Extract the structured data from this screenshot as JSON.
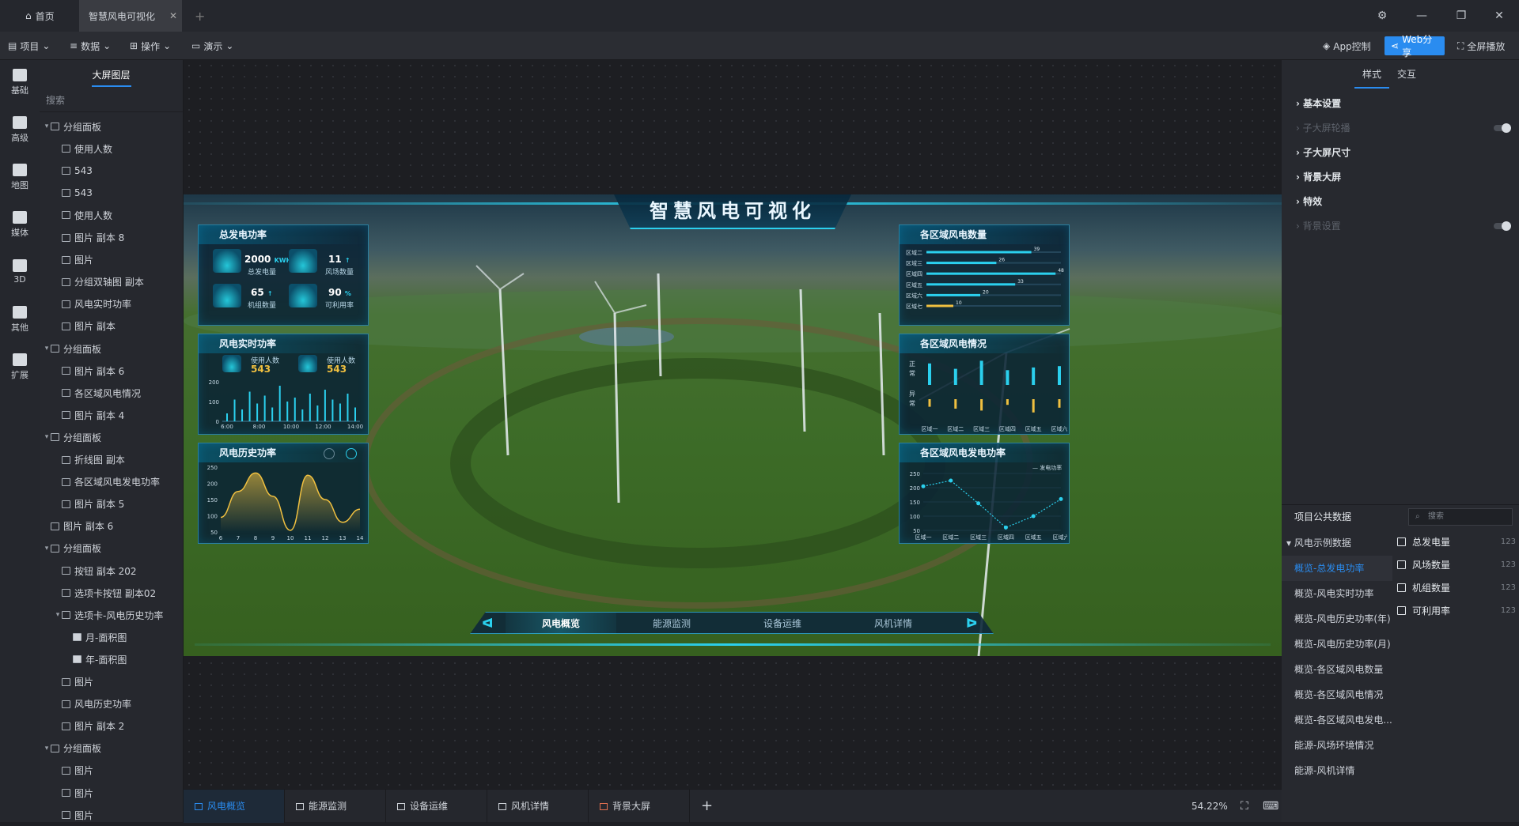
{
  "titlebar": {
    "home_label": "首页",
    "active_tab": "智慧风电可视化",
    "add_tab": "+",
    "settings_icon": "gear-icon"
  },
  "menubar": {
    "items": [
      "项目",
      "数据",
      "操作",
      "演示"
    ],
    "app_control": "App控制",
    "web_share": "Web分享",
    "fullscreen": "全屏播放"
  },
  "iconbar": {
    "items": [
      "基础",
      "高级",
      "地图",
      "媒体",
      "3D",
      "其他",
      "扩展"
    ]
  },
  "layers": {
    "tab": "大屏图层",
    "search_placeholder": "搜索",
    "rows": [
      {
        "label": "分组面板",
        "type": "group",
        "level": 0,
        "open": true
      },
      {
        "label": "使用人数",
        "type": "text",
        "level": 1
      },
      {
        "label": "543",
        "type": "text",
        "level": 1
      },
      {
        "label": "543",
        "type": "text",
        "level": 1
      },
      {
        "label": "使用人数",
        "type": "text",
        "level": 1
      },
      {
        "label": "图片 副本 8",
        "type": "image",
        "level": 1
      },
      {
        "label": "图片",
        "type": "image",
        "level": 1
      },
      {
        "label": "分组双轴图 副本",
        "type": "chart",
        "level": 1
      },
      {
        "label": "风电实时功率",
        "type": "text",
        "level": 1
      },
      {
        "label": "图片 副本",
        "type": "image",
        "level": 1
      },
      {
        "label": "分组面板",
        "type": "group",
        "level": 0,
        "open": true
      },
      {
        "label": "图片 副本 6",
        "type": "image",
        "level": 1
      },
      {
        "label": "各区域风电情况",
        "type": "text",
        "level": 1
      },
      {
        "label": "图片 副本 4",
        "type": "image",
        "level": 1
      },
      {
        "label": "分组面板",
        "type": "group",
        "level": 0,
        "open": true
      },
      {
        "label": "折线图 副本",
        "type": "line",
        "level": 1
      },
      {
        "label": "各区域风电发电功率",
        "type": "text",
        "level": 1
      },
      {
        "label": "图片 副本 5",
        "type": "image",
        "level": 1
      },
      {
        "label": "图片 副本 6",
        "type": "image",
        "level": 0
      },
      {
        "label": "分组面板",
        "type": "group",
        "level": 0,
        "open": true
      },
      {
        "label": "按钮 副本 202",
        "type": "button",
        "level": 1
      },
      {
        "label": "选项卡按钮 副本02",
        "type": "button",
        "level": 1
      },
      {
        "label": "选项卡-风电历史功率",
        "type": "tabs",
        "level": 1,
        "open": true
      },
      {
        "label": "月-面积图",
        "type": "folder",
        "level": 2
      },
      {
        "label": "年-面积图",
        "type": "folder",
        "level": 2
      },
      {
        "label": "图片",
        "type": "image",
        "level": 1
      },
      {
        "label": "风电历史功率",
        "type": "text",
        "level": 1
      },
      {
        "label": "图片 副本 2",
        "type": "image",
        "level": 1
      },
      {
        "label": "分组面板",
        "type": "group",
        "level": 0,
        "open": true
      },
      {
        "label": "图片",
        "type": "image",
        "level": 1
      },
      {
        "label": "图片",
        "type": "image",
        "level": 1
      },
      {
        "label": "图片",
        "type": "image",
        "level": 1
      }
    ]
  },
  "screen": {
    "title": "智慧风电可视化",
    "p1": {
      "title": "总发电功率",
      "k1_val": "2000",
      "k1_unit": "KWH",
      "k1_label": "总发电量",
      "k2_val": "11",
      "k2_label": "风场数量",
      "k3_val": "65",
      "k3_label": "机组数量",
      "k4_val": "90",
      "k4_unit": "%",
      "k4_label": "可利用率"
    },
    "p2": {
      "title": "风电实时功率",
      "u1_label": "使用人数",
      "u1_val": "543",
      "u2_label": "使用人数",
      "u2_val": "543"
    },
    "p3": {
      "title": "风电历史功率"
    },
    "p4": {
      "title": "各区域风电数量"
    },
    "p5": {
      "title": "各区域风电情况",
      "normal": "正常",
      "abnormal": "异常"
    },
    "p6": {
      "title": "各区域风电发电功率",
      "legend": "发电功率"
    },
    "nav": [
      "风电概览",
      "能源监测",
      "设备运维",
      "风机详情"
    ]
  },
  "chart_data": [
    {
      "type": "bar",
      "title": "风电实时功率",
      "x": [
        "6:00",
        "8:00",
        "10:00",
        "12:00",
        "14:00"
      ],
      "ylim": [
        0,
        200
      ],
      "yticks": [
        0,
        100,
        200
      ],
      "series": [
        {
          "values": [
            40,
            110,
            60,
            150,
            90,
            130,
            70,
            180,
            100,
            120,
            60,
            140,
            80,
            160,
            110,
            90,
            140,
            70
          ]
        }
      ]
    },
    {
      "type": "area",
      "title": "风电历史功率",
      "x": [
        6,
        7,
        8,
        9,
        10,
        11,
        12,
        13,
        14
      ],
      "ylim": [
        50,
        250
      ],
      "yticks": [
        50,
        100,
        150,
        200,
        250
      ],
      "series": [
        {
          "values": [
            95,
            175,
            232,
            160,
            55,
            225,
            150,
            80,
            120
          ]
        }
      ]
    },
    {
      "type": "bar",
      "title": "各区域风电数量",
      "categories": [
        "区域二",
        "区域三",
        "区域四",
        "区域五",
        "区域六",
        "区域七"
      ],
      "values": [
        39,
        26,
        48,
        33,
        20,
        10
      ],
      "xlim": [
        0,
        50
      ]
    },
    {
      "type": "bar",
      "title": "各区域风电情况",
      "categories": [
        "区域一",
        "区域二",
        "区域三",
        "区域四",
        "区域五",
        "区域六"
      ],
      "series": [
        {
          "name": "正常",
          "values": [
            0.8,
            0.6,
            0.9,
            0.55,
            0.65,
            0.7
          ]
        },
        {
          "name": "异常",
          "values": [
            0.4,
            0.5,
            0.6,
            0.3,
            0.7,
            0.45
          ]
        }
      ]
    },
    {
      "type": "line",
      "title": "各区域风电发电功率",
      "categories": [
        "区域一",
        "区域二",
        "区域三",
        "区域四",
        "区域五",
        "区域六"
      ],
      "ylim": [
        50,
        250
      ],
      "yticks": [
        50,
        100,
        150,
        200,
        250
      ],
      "series": [
        {
          "name": "发电功率",
          "values": [
            205,
            225,
            145,
            60,
            100,
            160
          ]
        }
      ]
    }
  ],
  "right": {
    "tabs": [
      "样式",
      "交互"
    ],
    "sections": [
      {
        "label": "基本设置",
        "enabled": true
      },
      {
        "label": "子大屏轮播",
        "enabled": false,
        "toggle": true
      },
      {
        "label": "子大屏尺寸",
        "enabled": true
      },
      {
        "label": "背景大屏",
        "enabled": true
      },
      {
        "label": "特效",
        "enabled": true
      },
      {
        "label": "背景设置",
        "enabled": false,
        "toggle": true
      }
    ],
    "pub_title": "项目公共数据",
    "pub_search": "搜索",
    "pub_group": "风电示例数据",
    "pub_items": [
      "概览-总发电功率",
      "概览-风电实时功率",
      "概览-风电历史功率(年)",
      "概览-风电历史功率(月)",
      "概览-各区域风电数量",
      "概览-各区域风电情况",
      "概览-各区域风电发电...",
      "能源-风场环境情况",
      "能源-风机详情"
    ],
    "fields": [
      {
        "label": "总发电量",
        "type": "123"
      },
      {
        "label": "风场数量",
        "type": "123"
      },
      {
        "label": "机组数量",
        "type": "123"
      },
      {
        "label": "可利用率",
        "type": "123"
      }
    ]
  },
  "bottom": {
    "tabs": [
      "风电概览",
      "能源监测",
      "设备运维",
      "风机详情",
      "背景大屏"
    ],
    "add": "+",
    "zoom": "54.22%"
  },
  "colors": {
    "accent": "#2a8cf0",
    "cyan": "#2bd0ee",
    "gold": "#f0c040"
  }
}
